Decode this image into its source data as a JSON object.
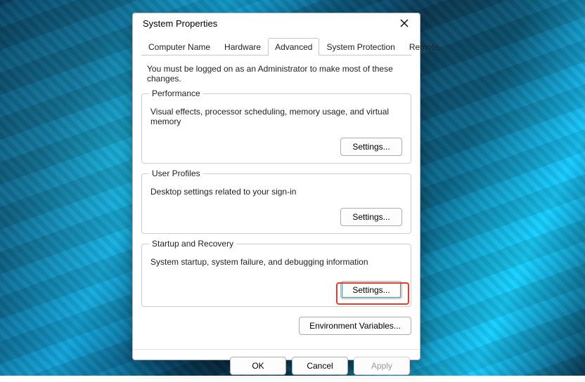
{
  "window": {
    "title": "System Properties"
  },
  "tabs": {
    "items": [
      {
        "label": "Computer Name"
      },
      {
        "label": "Hardware"
      },
      {
        "label": "Advanced"
      },
      {
        "label": "System Protection"
      },
      {
        "label": "Remote"
      }
    ],
    "active_index": 2
  },
  "advanced_panel": {
    "admin_message": "You must be logged on as an Administrator to make most of these changes.",
    "performance": {
      "title": "Performance",
      "desc": "Visual effects, processor scheduling, memory usage, and virtual memory",
      "button": "Settings..."
    },
    "user_profiles": {
      "title": "User Profiles",
      "desc": "Desktop settings related to your sign-in",
      "button": "Settings..."
    },
    "startup": {
      "title": "Startup and Recovery",
      "desc": "System startup, system failure, and debugging information",
      "button": "Settings..."
    },
    "env_button": "Environment Variables..."
  },
  "bottom": {
    "ok": "OK",
    "cancel": "Cancel",
    "apply": "Apply"
  }
}
